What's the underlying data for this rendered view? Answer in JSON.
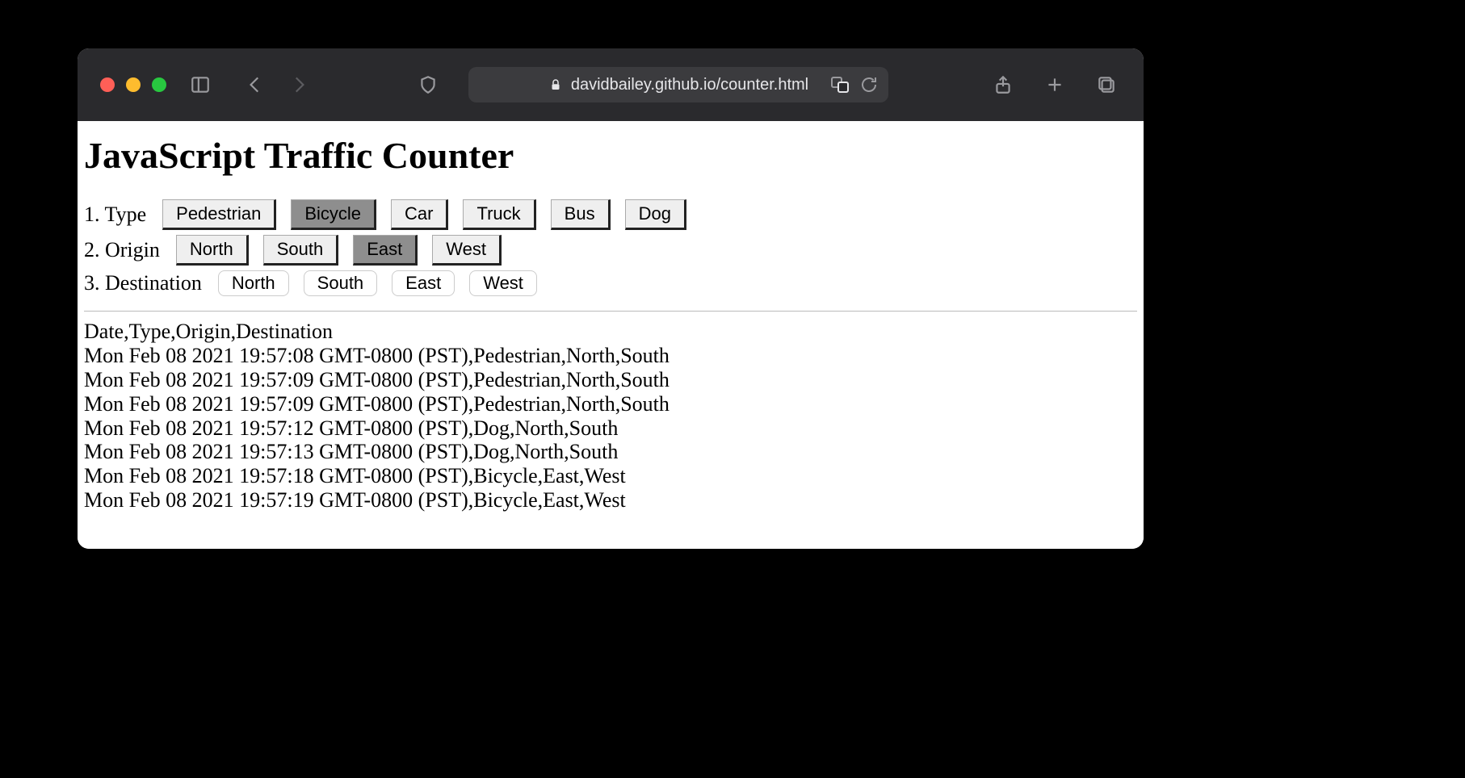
{
  "browser": {
    "url_display": "davidbailey.github.io/counter.html"
  },
  "page": {
    "title": "JavaScript Traffic Counter",
    "rows": {
      "type": {
        "label": "1. Type",
        "options": [
          "Pedestrian",
          "Bicycle",
          "Car",
          "Truck",
          "Bus",
          "Dog"
        ],
        "selected": "Bicycle"
      },
      "origin": {
        "label": "2. Origin",
        "options": [
          "North",
          "South",
          "East",
          "West"
        ],
        "selected": "East"
      },
      "destination": {
        "label": "3. Destination",
        "options": [
          "North",
          "South",
          "East",
          "West"
        ],
        "selected": null
      }
    },
    "log_header": "Date,Type,Origin,Destination",
    "log": [
      "Mon Feb 08 2021 19:57:08 GMT-0800 (PST),Pedestrian,North,South",
      "Mon Feb 08 2021 19:57:09 GMT-0800 (PST),Pedestrian,North,South",
      "Mon Feb 08 2021 19:57:09 GMT-0800 (PST),Pedestrian,North,South",
      "Mon Feb 08 2021 19:57:12 GMT-0800 (PST),Dog,North,South",
      "Mon Feb 08 2021 19:57:13 GMT-0800 (PST),Dog,North,South",
      "Mon Feb 08 2021 19:57:18 GMT-0800 (PST),Bicycle,East,West",
      "Mon Feb 08 2021 19:57:19 GMT-0800 (PST),Bicycle,East,West"
    ]
  }
}
